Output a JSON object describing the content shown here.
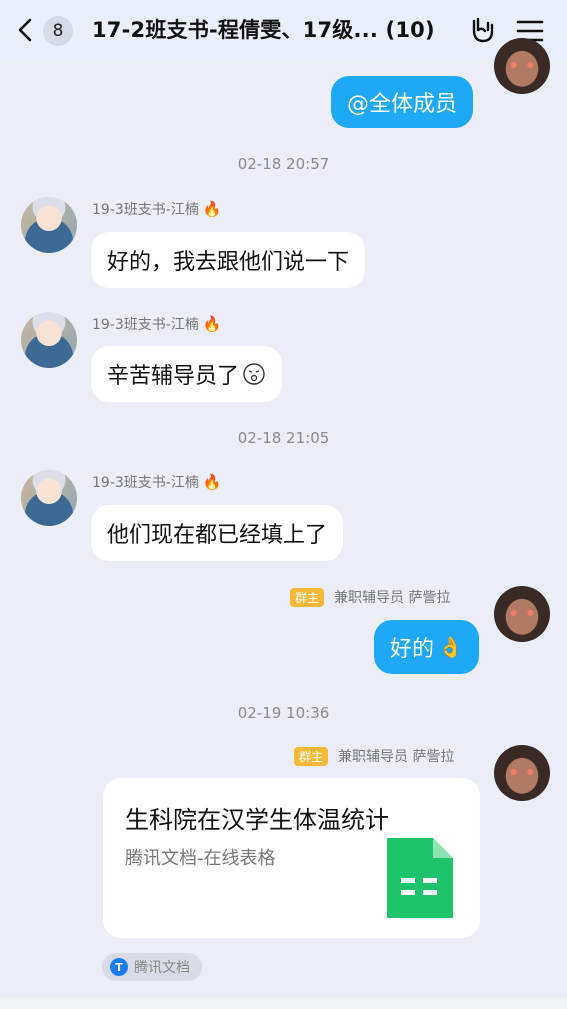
{
  "header": {
    "unread_count": "8",
    "title": "17-2班支书-程倩雯、17级... (10)"
  },
  "messages": {
    "m0_text": "@全体成员",
    "ts1": "02-18 20:57",
    "m1_sender": "19-3班支书-江楠",
    "m1_text": "好的，我去跟他们说一下",
    "m2_sender": "19-3班支书-江楠",
    "m2_text": "辛苦辅导员了",
    "ts2": "02-18 21:05",
    "m3_sender": "19-3班支书-江楠",
    "m3_text": "他们现在都已经填上了",
    "m4_badge": "群主",
    "m4_sender": "兼职辅导员 萨訾拉",
    "m4_text": "好的",
    "ts3": "02-19 10:36",
    "m5_badge": "群主",
    "m5_sender": "兼职辅导员 萨訾拉"
  },
  "doc_card": {
    "title": "生科院在汉学生体温统计",
    "subtitle": "腾讯文档-在线表格",
    "source": "腾讯文档"
  },
  "icons": {
    "back": "chevron-left-icon",
    "hand": "hand-gesture-icon",
    "menu": "menu-icon",
    "fire": "fire-icon",
    "sheet": "spreadsheet-icon"
  },
  "colors": {
    "outgoing_bubble": "#1fa8f5",
    "incoming_bubble": "#ffffff",
    "badge": "#f5b93a",
    "sheet_green": "#1fc46a"
  }
}
